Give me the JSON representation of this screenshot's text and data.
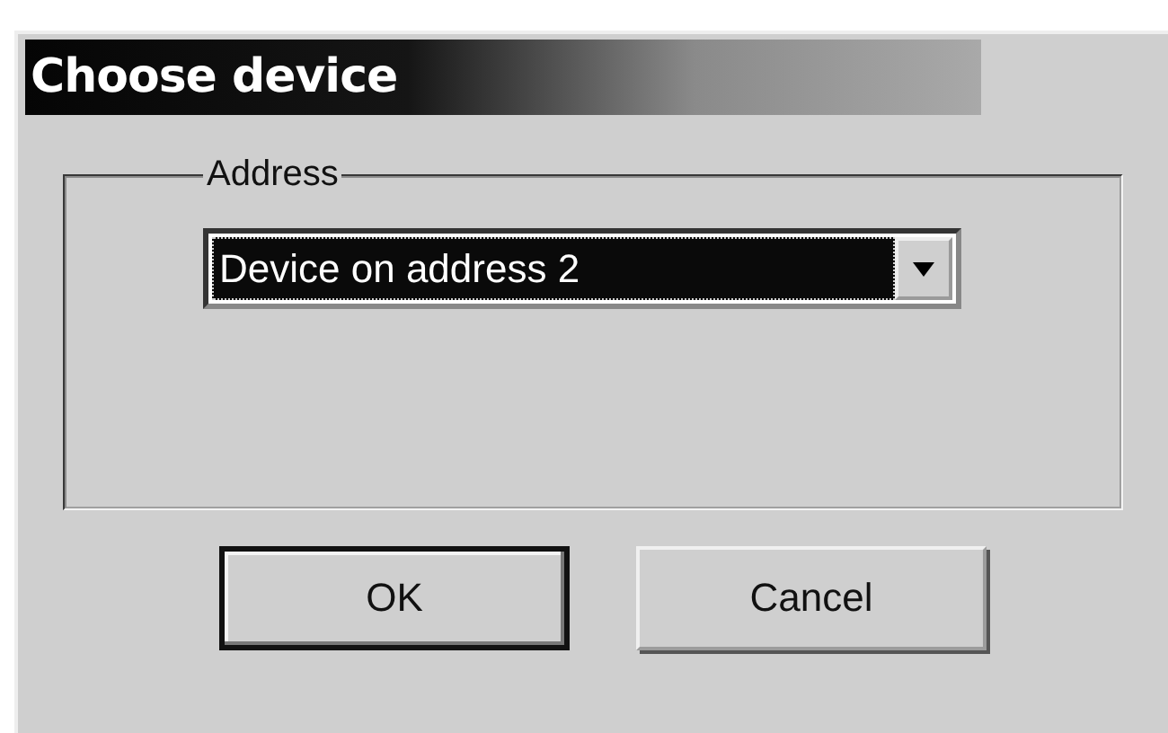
{
  "window": {
    "title": "Choose device"
  },
  "group": {
    "label": "Address",
    "dropdown": {
      "value": "Device on address 2",
      "focused": true
    }
  },
  "buttons": [
    {
      "label": "OK",
      "default": true
    },
    {
      "label": "Cancel",
      "default": false
    }
  ]
}
